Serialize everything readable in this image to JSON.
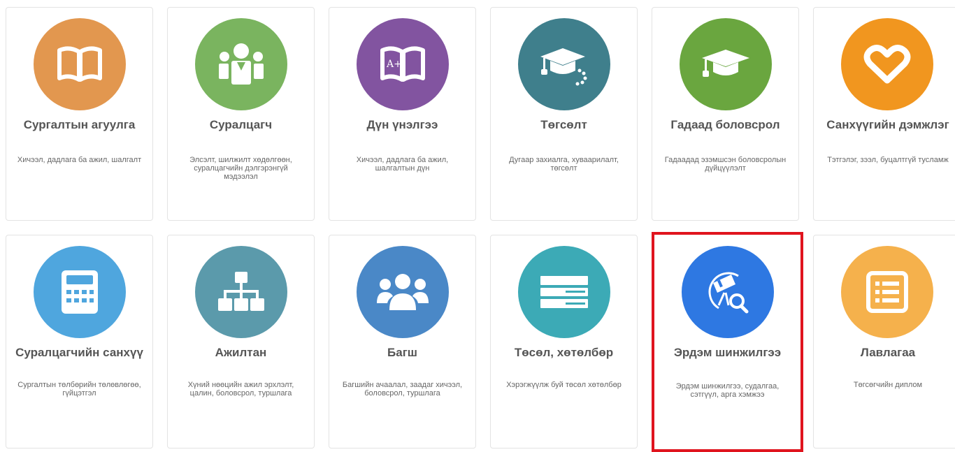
{
  "cards": [
    {
      "title": "Сургалтын агуулга",
      "desc": "Хичээл, дадлага ба ажил, шалгалт",
      "color": "#e2974f",
      "icon": "open-book-icon"
    },
    {
      "title": "Суралцагч",
      "desc": "Элсэлт, шилжилт хөдөлгөөн, суралцагчийн дэлгэрэнгүй мэдээлэл",
      "color": "#7ab45f",
      "icon": "students-group-icon"
    },
    {
      "title": "Дүн үнэлгээ",
      "desc": "Хичээл, дадлага ба ажил, шалгалтын дүн",
      "color": "#8254a0",
      "icon": "graded-book-icon"
    },
    {
      "title": "Төгсөлт",
      "desc": "Дугаар захиалга, хуваарилалт, төгсөлт",
      "color": "#3f7f8c",
      "icon": "graduation-cap-loading-icon"
    },
    {
      "title": "Гадаад боловсрол",
      "desc": "Гадаадад эзэмшсэн боловсролын дүйцүүлэлт",
      "color": "#6aa63f",
      "icon": "graduation-cap-icon"
    },
    {
      "title": "Санхүүгийн дэмжлэг",
      "desc": "Тэтгэлэг, зээл, буцалтгүй тусламж",
      "color": "#f1961f",
      "icon": "heart-icon"
    },
    {
      "title": "Суралцагчийн санхүү",
      "desc": "Сургалтын төлбөрийн төлөвлөгөө, гүйцэтгэл",
      "color": "#4fa6de",
      "icon": "calculator-icon"
    },
    {
      "title": "Ажилтан",
      "desc": "Хүний нөөцийн ажил эрхлэлт, цалин, боловсрол, туршлага",
      "color": "#5b9aab",
      "icon": "org-chart-icon"
    },
    {
      "title": "Багш",
      "desc": "Багшийн ачаалал, заадаг хичээл, боловсрол, туршлага",
      "color": "#4a88c7",
      "icon": "teachers-group-icon"
    },
    {
      "title": "Төсөл, хөтөлбөр",
      "desc": "Хэрэгжүүлж буй төсөл хөтөлбөр",
      "color": "#3caab6",
      "icon": "list-bars-icon"
    },
    {
      "title": "Эрдэм шинжилгээ",
      "desc": "Эрдэм шинжилгээ, судалгаа, сэтгүүл, арга хэмжээ",
      "color": "#2e78e2",
      "icon": "telescope-search-icon"
    },
    {
      "title": "Лавлагаа",
      "desc": "Төгсөгчийн диплом",
      "color": "#f5b14c",
      "icon": "list-document-icon"
    }
  ]
}
